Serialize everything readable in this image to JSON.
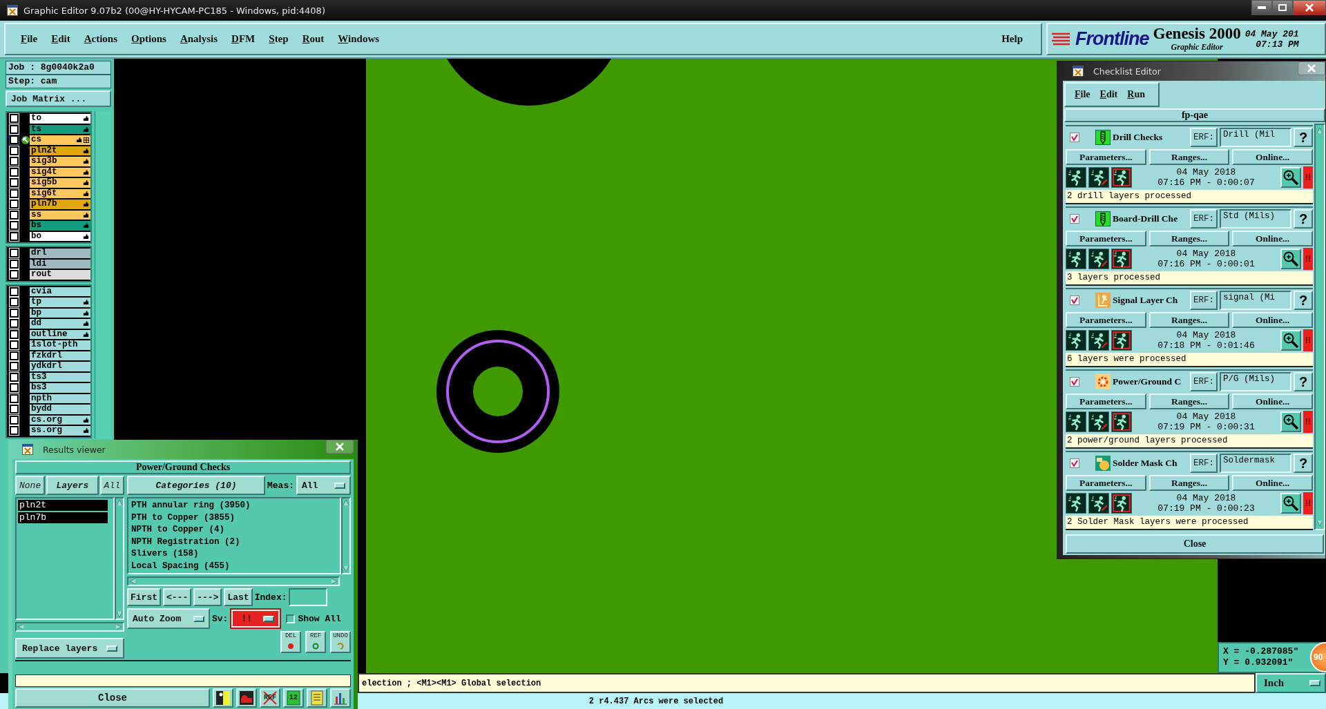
{
  "window": {
    "title": "Graphic Editor 9.07b2 (00@HY-HYCAM-PC185 - Windows, pid:4408)"
  },
  "menu": [
    "File",
    "Edit",
    "Actions",
    "Options",
    "Analysis",
    "DFM",
    "Step",
    "Rout",
    "Windows"
  ],
  "help": "Help",
  "branding": {
    "logo": "Frontline",
    "product": "Genesis 2000",
    "module": "Graphic Editor",
    "date": "04 May 201",
    "time": "07:13 PM"
  },
  "job": {
    "job": "Job : 8g0040k2a0",
    "step": "Step: cam",
    "matrix_button": "Job Matrix ..."
  },
  "layer_groups": [
    [
      {
        "name": "to",
        "color": "#ffffff",
        "checked": false,
        "flagged": true,
        "work": false
      },
      {
        "name": "ts",
        "color": "#139c7e",
        "checked": false,
        "flagged": true,
        "work": false
      },
      {
        "name": "cs",
        "color": "#ffc85c",
        "checked": false,
        "flagged": true,
        "work": true
      },
      {
        "name": "pln2t",
        "color": "#e0a80a",
        "checked": false,
        "flagged": true,
        "work": false
      },
      {
        "name": "sig3b",
        "color": "#ffc85c",
        "checked": false,
        "flagged": true,
        "work": false
      },
      {
        "name": "sig4t",
        "color": "#ffc85c",
        "checked": false,
        "flagged": true,
        "work": false
      },
      {
        "name": "sig5b",
        "color": "#ffc85c",
        "checked": false,
        "flagged": true,
        "work": false
      },
      {
        "name": "sig6t",
        "color": "#ffc85c",
        "checked": false,
        "flagged": true,
        "work": false
      },
      {
        "name": "pln7b",
        "color": "#e0a80a",
        "checked": false,
        "flagged": true,
        "work": false
      },
      {
        "name": "ss",
        "color": "#ffc85c",
        "checked": false,
        "flagged": true,
        "work": false
      },
      {
        "name": "bs",
        "color": "#139c7e",
        "checked": false,
        "flagged": true,
        "work": false
      },
      {
        "name": "bo",
        "color": "#ffffff",
        "checked": false,
        "flagged": true,
        "work": false
      }
    ],
    [
      {
        "name": "drl",
        "color": "#a0b8c0",
        "checked": false,
        "flagged": false,
        "work": false
      },
      {
        "name": "ldi",
        "color": "#a0b8c0",
        "checked": false,
        "flagged": false,
        "work": false
      },
      {
        "name": "rout",
        "color": "#dcdcdc",
        "checked": false,
        "flagged": false,
        "work": false
      }
    ],
    [
      {
        "name": "cvia",
        "color": "#a0dcdc",
        "checked": false,
        "flagged": false,
        "work": false
      },
      {
        "name": "tp",
        "color": "#a0dcdc",
        "checked": false,
        "flagged": true,
        "work": false
      },
      {
        "name": "bp",
        "color": "#a0dcdc",
        "checked": false,
        "flagged": true,
        "work": false
      },
      {
        "name": "dd",
        "color": "#a0dcdc",
        "checked": false,
        "flagged": true,
        "work": false
      },
      {
        "name": "outline",
        "color": "#a0dcdc",
        "checked": false,
        "flagged": true,
        "work": false
      },
      {
        "name": "1slot-pth",
        "color": "#a0dcdc",
        "checked": false,
        "flagged": false,
        "work": false
      },
      {
        "name": "fzkdrl",
        "color": "#a0dcdc",
        "checked": false,
        "flagged": false,
        "work": false
      },
      {
        "name": "ydkdrl",
        "color": "#a0dcdc",
        "checked": false,
        "flagged": false,
        "work": false
      },
      {
        "name": "ts3",
        "color": "#a0dcdc",
        "checked": false,
        "flagged": false,
        "work": false
      },
      {
        "name": "bs3",
        "color": "#a0dcdc",
        "checked": false,
        "flagged": false,
        "work": false
      },
      {
        "name": "npth",
        "color": "#a0dcdc",
        "checked": false,
        "flagged": false,
        "work": false
      },
      {
        "name": "bydd",
        "color": "#a0dcdc",
        "checked": false,
        "flagged": false,
        "work": false
      },
      {
        "name": "cs.org",
        "color": "#a0dcdc",
        "checked": false,
        "flagged": true,
        "work": false
      },
      {
        "name": "ss.org",
        "color": "#a0dcdc",
        "checked": false,
        "flagged": true,
        "work": false
      }
    ]
  ],
  "checklist": {
    "title": "Checklist Editor",
    "menu": [
      "File",
      "Edit",
      "Run"
    ],
    "name": "fp-qae",
    "items": [
      {
        "kind": "drill",
        "checked": true,
        "name": "Drill Checks",
        "erf_label": "ERF:",
        "erf": "Drill (Mil",
        "help": "?",
        "buttons": [
          "Parameters...",
          "Ranges...",
          "Online..."
        ],
        "date": "04 May 2018",
        "time": "07:16 PM - 0:00:07",
        "alert": "!!",
        "message": "2 drill layers processed"
      },
      {
        "kind": "drill",
        "checked": true,
        "name": "Board-Drill Che",
        "erf_label": "ERF:",
        "erf": "Std (Mils)",
        "help": "?",
        "buttons": [
          "Parameters...",
          "Ranges...",
          "Online..."
        ],
        "date": "04 May 2018",
        "time": "07:16 PM - 0:00:01",
        "alert": "!!",
        "message": "3 layers processed"
      },
      {
        "kind": "signal",
        "checked": true,
        "name": "Signal Layer Ch",
        "erf_label": "ERF:",
        "erf": "signal (Mi",
        "help": "?",
        "buttons": [
          "Parameters...",
          "Ranges...",
          "Online..."
        ],
        "date": "04 May 2018",
        "time": "07:18 PM - 0:01:46",
        "alert": "!!",
        "message": "6 layers were processed"
      },
      {
        "kind": "power",
        "checked": true,
        "name": "Power/Ground C",
        "erf_label": "ERF:",
        "erf": "P/G (Mils)",
        "help": "?",
        "buttons": [
          "Parameters...",
          "Ranges...",
          "Online..."
        ],
        "date": "04 May 2018",
        "time": "07:19 PM - 0:00:31",
        "alert": "!!",
        "message": "2 power/ground layers processed"
      },
      {
        "kind": "mask",
        "checked": true,
        "name": "Solder Mask Ch",
        "erf_label": "ERF:",
        "erf": "Soldermask",
        "help": "?",
        "buttons": [
          "Parameters...",
          "Ranges...",
          "Online..."
        ],
        "date": "04 May 2018",
        "time": "07:19 PM - 0:00:23",
        "alert": "!!",
        "message": "2 Solder Mask layers were processed"
      }
    ],
    "close": "Close"
  },
  "results": {
    "title": "Results viewer",
    "check": "Power/Ground Checks",
    "layer_buttons": [
      "None",
      "Layers",
      "All"
    ],
    "layers": [
      {
        "name": "pln2t",
        "selected": true
      },
      {
        "name": "pln7b",
        "selected": true
      }
    ],
    "categories_button": "Categories (10)",
    "meas_label": "Meas:",
    "meas": "All",
    "categories": [
      {
        "label": "PTH annular ring (3950)",
        "selected": false
      },
      {
        "label": "PTH to Copper (3855)",
        "selected": false
      },
      {
        "label": "NPTH to Copper (4)",
        "selected": false
      },
      {
        "label": "NPTH Registration (2)",
        "selected": false
      },
      {
        "label": "Slivers (158)",
        "selected": false
      },
      {
        "label": "Local Spacing (455)",
        "selected": false
      }
    ],
    "nav": [
      "First",
      "<---",
      "--->",
      "Last"
    ],
    "index_label": "Index:",
    "zoom_mode": "Auto Zoom",
    "sv_label": "Sv:",
    "sv": "!!",
    "show_all": {
      "label": "Show All",
      "checked": false
    },
    "replace": "Replace layers",
    "tools": [
      {
        "kind": "delete",
        "label": "DEL"
      },
      {
        "kind": "ref",
        "label": "REF"
      },
      {
        "kind": "undo",
        "label": "UNDO"
      }
    ],
    "close": "Close",
    "bottom_tools": [
      {
        "kind": "person"
      },
      {
        "kind": "stop"
      },
      {
        "kind": "crossed",
        "label": "REF"
      },
      {
        "kind": "number",
        "label": "12"
      },
      {
        "kind": "notes"
      },
      {
        "kind": "bars"
      }
    ]
  },
  "status": {
    "message": "election ; <M1><M1> Global selection",
    "units": "Inch",
    "coordinates": [
      "X = -0.287085\"",
      "Y = 0.932091\""
    ],
    "badge": "90",
    "info": "2 r4.437 Arcs were selected"
  }
}
